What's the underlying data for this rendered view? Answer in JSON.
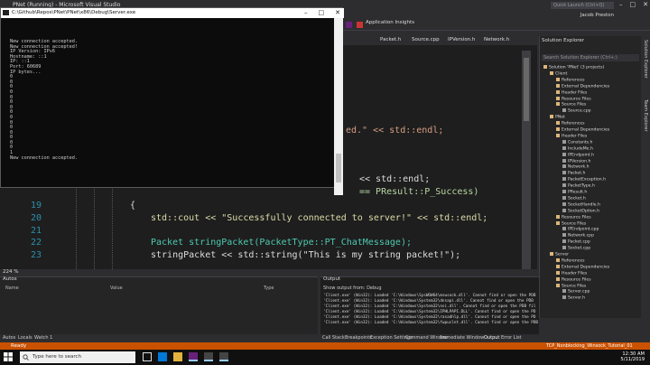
{
  "vs": {
    "title": "PNet (Running) - Microsoft Visual Studio",
    "quick_launch": "Quick Launch (Ctrl+Q)",
    "user": "Jacob Preston",
    "app_insights": "Application Insights",
    "tabs": [
      "Packet.h",
      "Source.cpp",
      "IPVersion.h",
      "Network.h"
    ],
    "zoom": "224 %"
  },
  "console": {
    "title": "C:\\Github\\Repos\\PNet\\PNet\\x86\\Debug\\Server.exe",
    "lines": [
      "New connection accepted.",
      "New connection accepted!",
      "IP Version: IPv6",
      "Hostname: ::1",
      "IP: ::1",
      "Port: 60689",
      "IP bytes...",
      "0",
      "0",
      "0",
      "0",
      "0",
      "0",
      "0",
      "0",
      "0",
      "0",
      "0",
      "0",
      "0",
      "0",
      "0",
      "1",
      "New connection accepted."
    ]
  },
  "editor": {
    "partial_line1": "ed.\" << std::endl;",
    "partial_line2": "<< std::endl;",
    "partial_line3": "== PResult::P_Success)",
    "lines": [
      {
        "num": "19",
        "text": "{"
      },
      {
        "num": "20",
        "text": "std::cout << \"Successfully connected to server!\" << std::endl;"
      },
      {
        "num": "21",
        "text": ""
      },
      {
        "num": "22",
        "text": "Packet stringPacket(PacketType::PT_ChatMessage);"
      },
      {
        "num": "23",
        "text": "stringPacket << std::string(\"This is my string packet!\");"
      }
    ]
  },
  "solution": {
    "header": "Solution Explorer",
    "search": "Search Solution Explorer (Ctrl+;)",
    "items": [
      {
        "label": "Solution 'PNet' (3 projects)",
        "indent": 0
      },
      {
        "label": "Client",
        "indent": 1
      },
      {
        "label": "References",
        "indent": 2
      },
      {
        "label": "External Dependencies",
        "indent": 2
      },
      {
        "label": "Header Files",
        "indent": 2
      },
      {
        "label": "Resource Files",
        "indent": 2
      },
      {
        "label": "Source Files",
        "indent": 2
      },
      {
        "label": "Source.cpp",
        "indent": 3
      },
      {
        "label": "PNet",
        "indent": 1
      },
      {
        "label": "References",
        "indent": 2
      },
      {
        "label": "External Dependencies",
        "indent": 2
      },
      {
        "label": "Header Files",
        "indent": 2
      },
      {
        "label": "Constants.h",
        "indent": 3
      },
      {
        "label": "IncludeMe.h",
        "indent": 3
      },
      {
        "label": "IPEndpoint.h",
        "indent": 3
      },
      {
        "label": "IPVersion.h",
        "indent": 3
      },
      {
        "label": "Network.h",
        "indent": 3
      },
      {
        "label": "Packet.h",
        "indent": 3
      },
      {
        "label": "PacketException.h",
        "indent": 3
      },
      {
        "label": "PacketType.h",
        "indent": 3
      },
      {
        "label": "PResult.h",
        "indent": 3
      },
      {
        "label": "Socket.h",
        "indent": 3
      },
      {
        "label": "SocketHandle.h",
        "indent": 3
      },
      {
        "label": "SocketOption.h",
        "indent": 3
      },
      {
        "label": "Resource Files",
        "indent": 2
      },
      {
        "label": "Source Files",
        "indent": 2
      },
      {
        "label": "IPEndpoint.cpp",
        "indent": 3
      },
      {
        "label": "Network.cpp",
        "indent": 3
      },
      {
        "label": "Packet.cpp",
        "indent": 3
      },
      {
        "label": "Socket.cpp",
        "indent": 3
      },
      {
        "label": "Server",
        "indent": 1
      },
      {
        "label": "References",
        "indent": 2
      },
      {
        "label": "External Dependencies",
        "indent": 2
      },
      {
        "label": "Header Files",
        "indent": 2
      },
      {
        "label": "Resource Files",
        "indent": 2
      },
      {
        "label": "Source Files",
        "indent": 2
      },
      {
        "label": "Server.cpp",
        "indent": 3
      },
      {
        "label": "Server.h",
        "indent": 3
      }
    ],
    "vertical_tabs": [
      "Solution Explorer",
      "Team Explorer"
    ]
  },
  "autos": {
    "title": "Autos",
    "columns": [
      "Name",
      "Value",
      "Type"
    ],
    "tabs": [
      "Autos",
      "Locals",
      "Watch 1"
    ]
  },
  "output": {
    "title": "Output",
    "show_from": "Show output from:",
    "source": "Debug",
    "lines": [
      "'Client.exe' (Win32): Loaded 'C:\\Windows\\SysWOW64\\mswsock.dll'. Cannot find or open the PDB",
      "'Client.exe' (Win32): Loaded 'C:\\Windows\\System32\\dnsapi.dll'. Cannot find or open the PDB",
      "'Client.exe' (Win32): Loaded 'C:\\Windows\\System32\\nsi.dll'. Cannot find or open the PDB fil",
      "'Client.exe' (Win32): Loaded 'C:\\Windows\\System32\\IPHLPAPI.DLL'. Cannot find or open the PD",
      "'Client.exe' (Win32): Loaded 'C:\\Windows\\System32\\rasadhlp.dll'. Cannot find or open the PD",
      "'Client.exe' (Win32): Loaded 'C:\\Windows\\System32\\fwpuclnt.dll'. Cannot find or open the PDB"
    ],
    "tabs": [
      "Call Stack",
      "Breakpoints",
      "Exception Settings",
      "Command Window",
      "Immediate Window",
      "Output",
      "Error List"
    ]
  },
  "status": {
    "ready": "Ready",
    "repo": "TCP_Nonblocking_Winsock_Tutorial_01"
  },
  "taskbar": {
    "search": "Type here to search",
    "time": "12:30 AM",
    "date": "5/11/2019"
  },
  "colors": {
    "status_bar": "#ca5100",
    "editor_bg": "#1e1e1e",
    "console_bg": "#0c0c0c"
  }
}
